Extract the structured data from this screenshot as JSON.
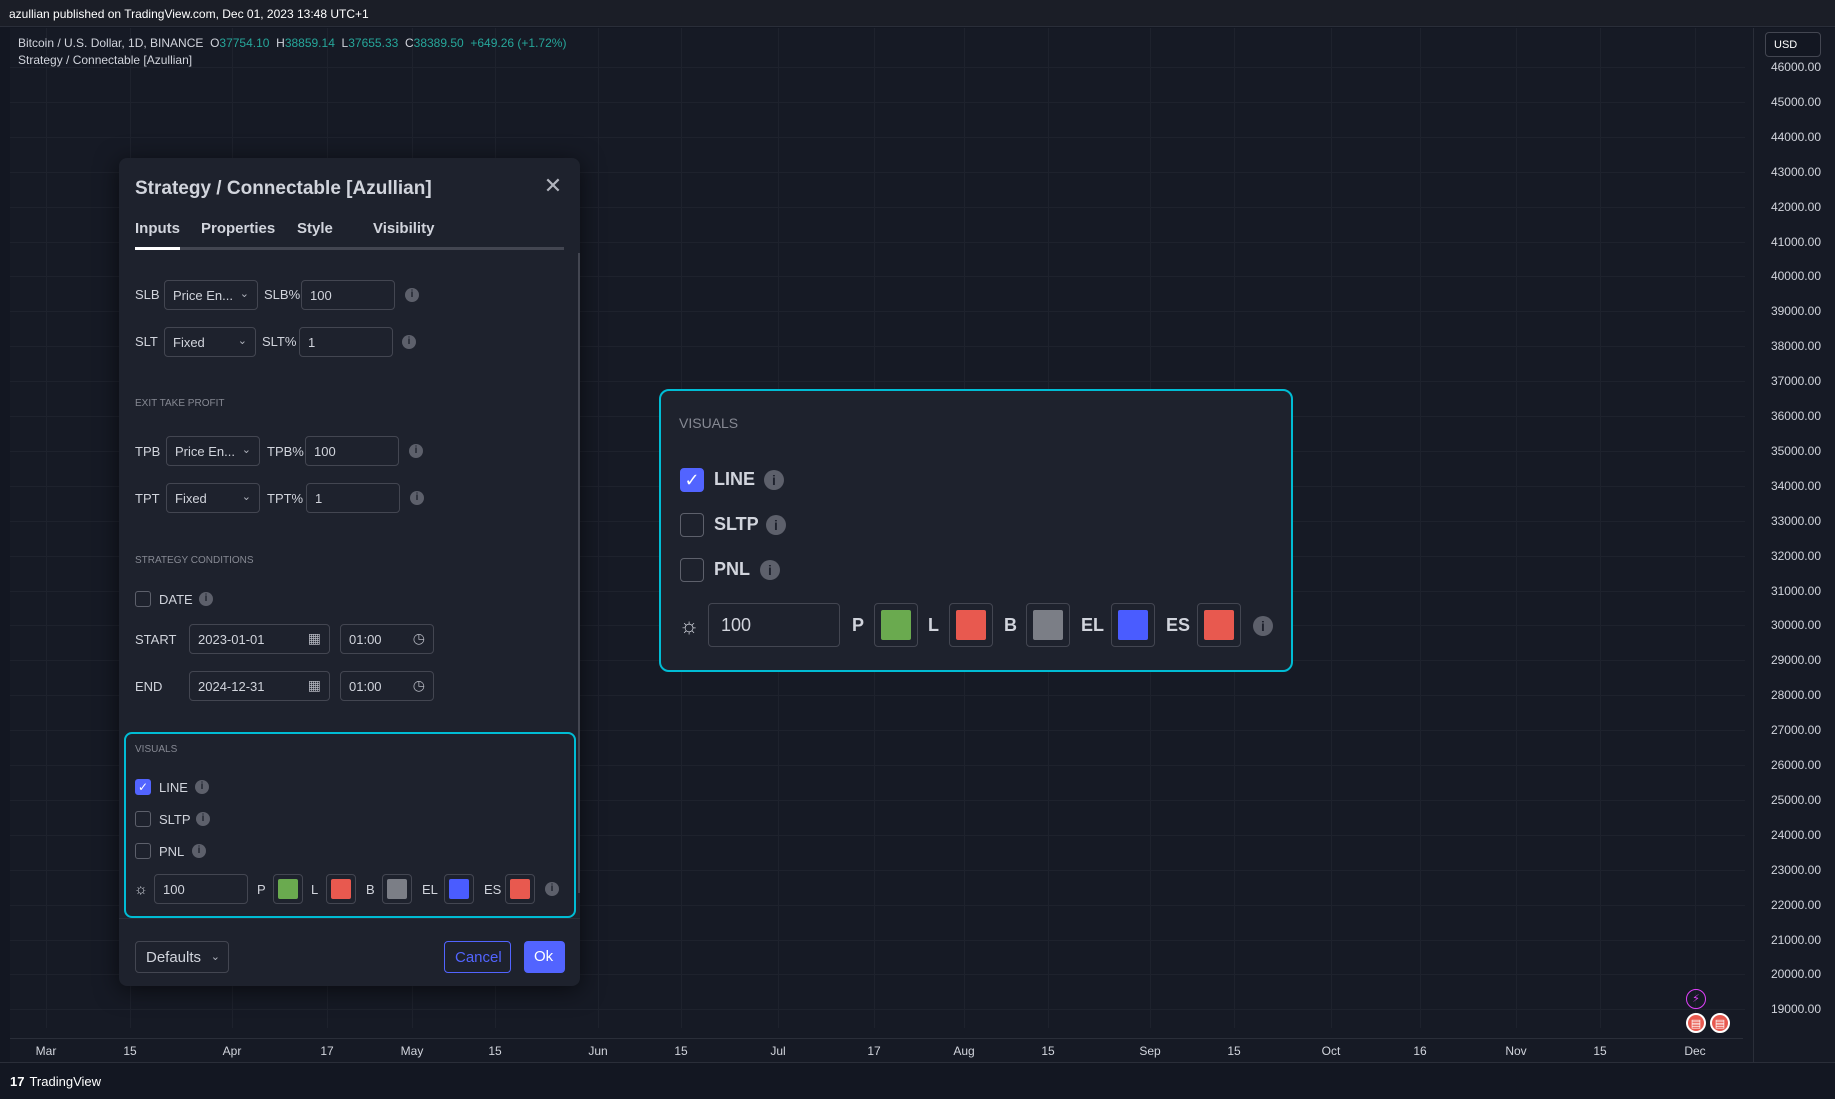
{
  "publish_bar": {
    "text": "azullian published on TradingView.com, Dec 01, 2023 13:48 UTC+1"
  },
  "legend": {
    "symbol": "Bitcoin / U.S. Dollar, 1D, BINANCE",
    "o_label": "O",
    "o": "37754.10",
    "h_label": "H",
    "h": "38859.14",
    "l_label": "L",
    "l": "37655.33",
    "c_label": "C",
    "c": "38389.50",
    "change": "+649.26 (+1.72%)",
    "indicator": "Strategy / Connectable [Azullian]"
  },
  "price_axis": {
    "currency": "USD",
    "labels": [
      "46000.00",
      "45000.00",
      "44000.00",
      "43000.00",
      "42000.00",
      "41000.00",
      "40000.00",
      "39000.00",
      "38000.00",
      "37000.00",
      "36000.00",
      "35000.00",
      "34000.00",
      "33000.00",
      "32000.00",
      "31000.00",
      "30000.00",
      "29000.00",
      "28000.00",
      "27000.00",
      "26000.00",
      "25000.00",
      "24000.00",
      "23000.00",
      "22000.00",
      "21000.00",
      "20000.00",
      "19000.00"
    ]
  },
  "time_axis": {
    "labels": [
      "Mar",
      "15",
      "Apr",
      "17",
      "May",
      "15",
      "Jun",
      "15",
      "Jul",
      "17",
      "Aug",
      "15",
      "Sep",
      "15",
      "Oct",
      "16",
      "Nov",
      "15",
      "Dec"
    ]
  },
  "footer": {
    "logo": "17",
    "brand": "TradingView"
  },
  "dialog": {
    "title": "Strategy / Connectable [Azullian]",
    "close": "✕",
    "tabs": [
      "Inputs",
      "Properties",
      "Style",
      "Visibility"
    ],
    "slb": {
      "label": "SLB",
      "select": "Price En...",
      "pct_label": "SLB%",
      "value": "100"
    },
    "slt": {
      "label": "SLT",
      "select": "Fixed",
      "pct_label": "SLT%",
      "value": "1"
    },
    "exit_tp_section": "EXIT TAKE PROFIT",
    "tpb": {
      "label": "TPB",
      "select": "Price En...",
      "pct_label": "TPB%",
      "value": "100"
    },
    "tpt": {
      "label": "TPT",
      "select": "Fixed",
      "pct_label": "TPT%",
      "value": "1"
    },
    "conditions_section": "STRATEGY CONDITIONS",
    "date_label": "DATE",
    "start": {
      "label": "START",
      "date": "2023-01-01",
      "time": "01:00"
    },
    "end": {
      "label": "END",
      "date": "2024-12-31",
      "time": "01:00"
    },
    "visuals": {
      "section": "VISUALS",
      "line": "LINE",
      "sltp": "SLTP",
      "pnl": "PNL",
      "opacity": "100",
      "p": "P",
      "l": "L",
      "b": "B",
      "el": "EL",
      "es": "ES"
    },
    "buttons": {
      "defaults": "Defaults",
      "cancel": "Cancel",
      "ok": "Ok"
    }
  },
  "colors": {
    "accent": "#5264ff",
    "highlight": "#00bcd4",
    "p": "#6aaa4f",
    "l": "#e8594f",
    "b": "#7b7e86",
    "el": "#4a5cff",
    "es": "#e8594f"
  },
  "icons": {
    "info": "i",
    "chevron": "⌄",
    "calendar": "▦",
    "clock": "◷",
    "sun": "☼"
  }
}
